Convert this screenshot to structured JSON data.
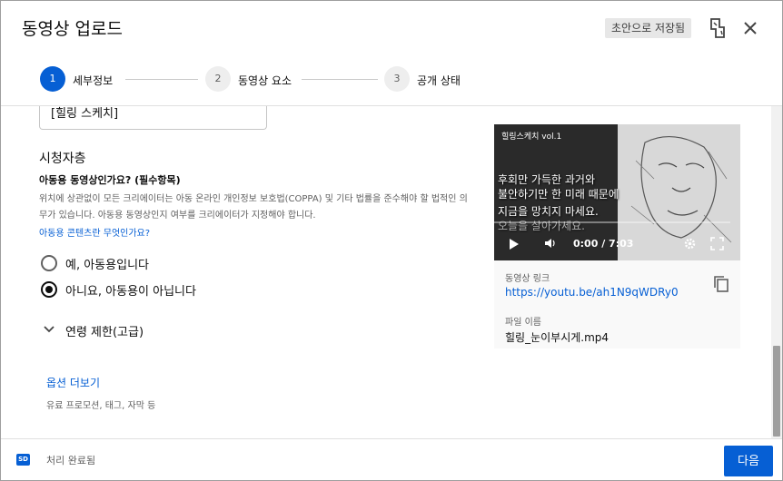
{
  "header": {
    "title": "동영상 업로드",
    "draft_badge": "초안으로 저장됨"
  },
  "stepper": {
    "steps": [
      {
        "number": "1",
        "label": "세부정보",
        "state": "active"
      },
      {
        "number": "2",
        "label": "동영상 요소",
        "state": "inactive"
      },
      {
        "number": "3",
        "label": "공개 상태",
        "state": "inactive"
      }
    ]
  },
  "form": {
    "playlist_value": "[힐링 스케치]",
    "audience": {
      "title": "시청자층",
      "question": "아동용 동영상인가요? (필수항목)",
      "description": "위치에 상관없이 모든 크리에이터는 아동 온라인 개인정보 보호법(COPPA) 및 기타 법률을 준수해야 할 법적인 의무가 있습니다. 아동용 동영상인지 여부를 크리에이터가 지정해야 합니다.",
      "link": "아동용 콘텐츠란 무엇인가요?",
      "options": [
        {
          "label": "예, 아동용입니다",
          "checked": false
        },
        {
          "label": "아니요, 아동용이 아닙니다",
          "checked": true
        }
      ]
    },
    "age_restriction": "연령 제한(고급)",
    "more_options": "옵션 더보기",
    "more_options_sub": "유료 프로모션, 태그, 자막 등"
  },
  "preview": {
    "video_title": "힐링스케치 vol.1",
    "captions": [
      "후회만 가득한 과거와",
      "불안하기만 한 미래 때문에",
      "지금을 망치지 마세요.",
      "오늘을 살아가세요."
    ],
    "time": "0:00 / 7:03",
    "link_label": "동영상 링크",
    "link_value": "https://youtu.be/ah1N9qWDRy0",
    "file_label": "파일 이름",
    "file_value": "힐링_눈이부시게.mp4"
  },
  "footer": {
    "quality_badge": "SD",
    "status": "처리 완료됨",
    "next_label": "다음"
  },
  "colors": {
    "accent": "#065fd4",
    "secondary_text": "#606060"
  }
}
